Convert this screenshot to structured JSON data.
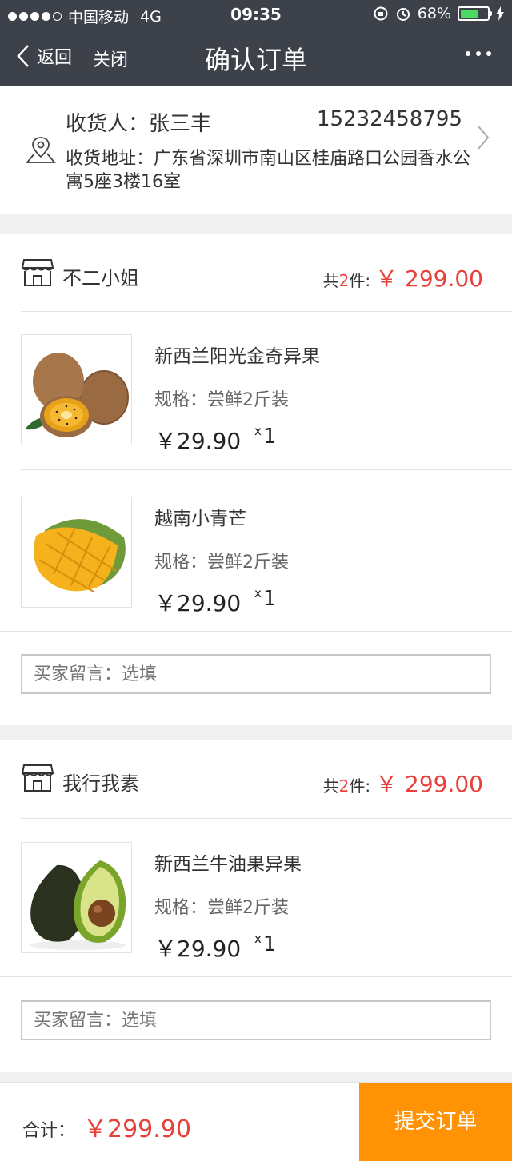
{
  "status_bar": {
    "carrier": "中国移动",
    "network": "4G",
    "time": "09:35",
    "battery": "68%",
    "battery_level": 0.68
  },
  "nav": {
    "back_label": "返回",
    "close_label": "关闭",
    "title": "确认订单"
  },
  "address": {
    "receiver": "收货人：张三丰",
    "phone": "15232458795",
    "detail": "收货地址：广东省深圳市南山区桂庙路口公园香水公寓5座3楼16室"
  },
  "shops": [
    {
      "name": "不二小姐",
      "count_prefix": "共",
      "count": "2",
      "count_suffix": "件:",
      "amount": "￥ 299.00",
      "items": [
        {
          "name": "新西兰阳光金奇异果",
          "spec": "规格：尝鲜2斤装",
          "price": "￥29.90",
          "qty": "1",
          "image": "kiwi"
        },
        {
          "name": "越南小青芒",
          "spec": "规格：尝鲜2斤装",
          "price": "￥29.90",
          "qty": "1",
          "image": "mango"
        }
      ],
      "note_placeholder": "买家留言：选填"
    },
    {
      "name": "我行我素",
      "count_prefix": "共",
      "count": "2",
      "count_suffix": "件:",
      "amount": "￥ 299.00",
      "items": [
        {
          "name": "新西兰牛油果异果",
          "spec": "规格：尝鲜2斤装",
          "price": "￥29.90",
          "qty": "1",
          "image": "avocado"
        }
      ],
      "note_placeholder": "买家留言：选填"
    }
  ],
  "footer": {
    "total_label": "合计：",
    "total": "￥299.90",
    "submit_label": "提交订单"
  },
  "colors": {
    "header_bg": "#3d414a",
    "price_red": "#e8413c",
    "submit_orange": "#ff9205"
  }
}
